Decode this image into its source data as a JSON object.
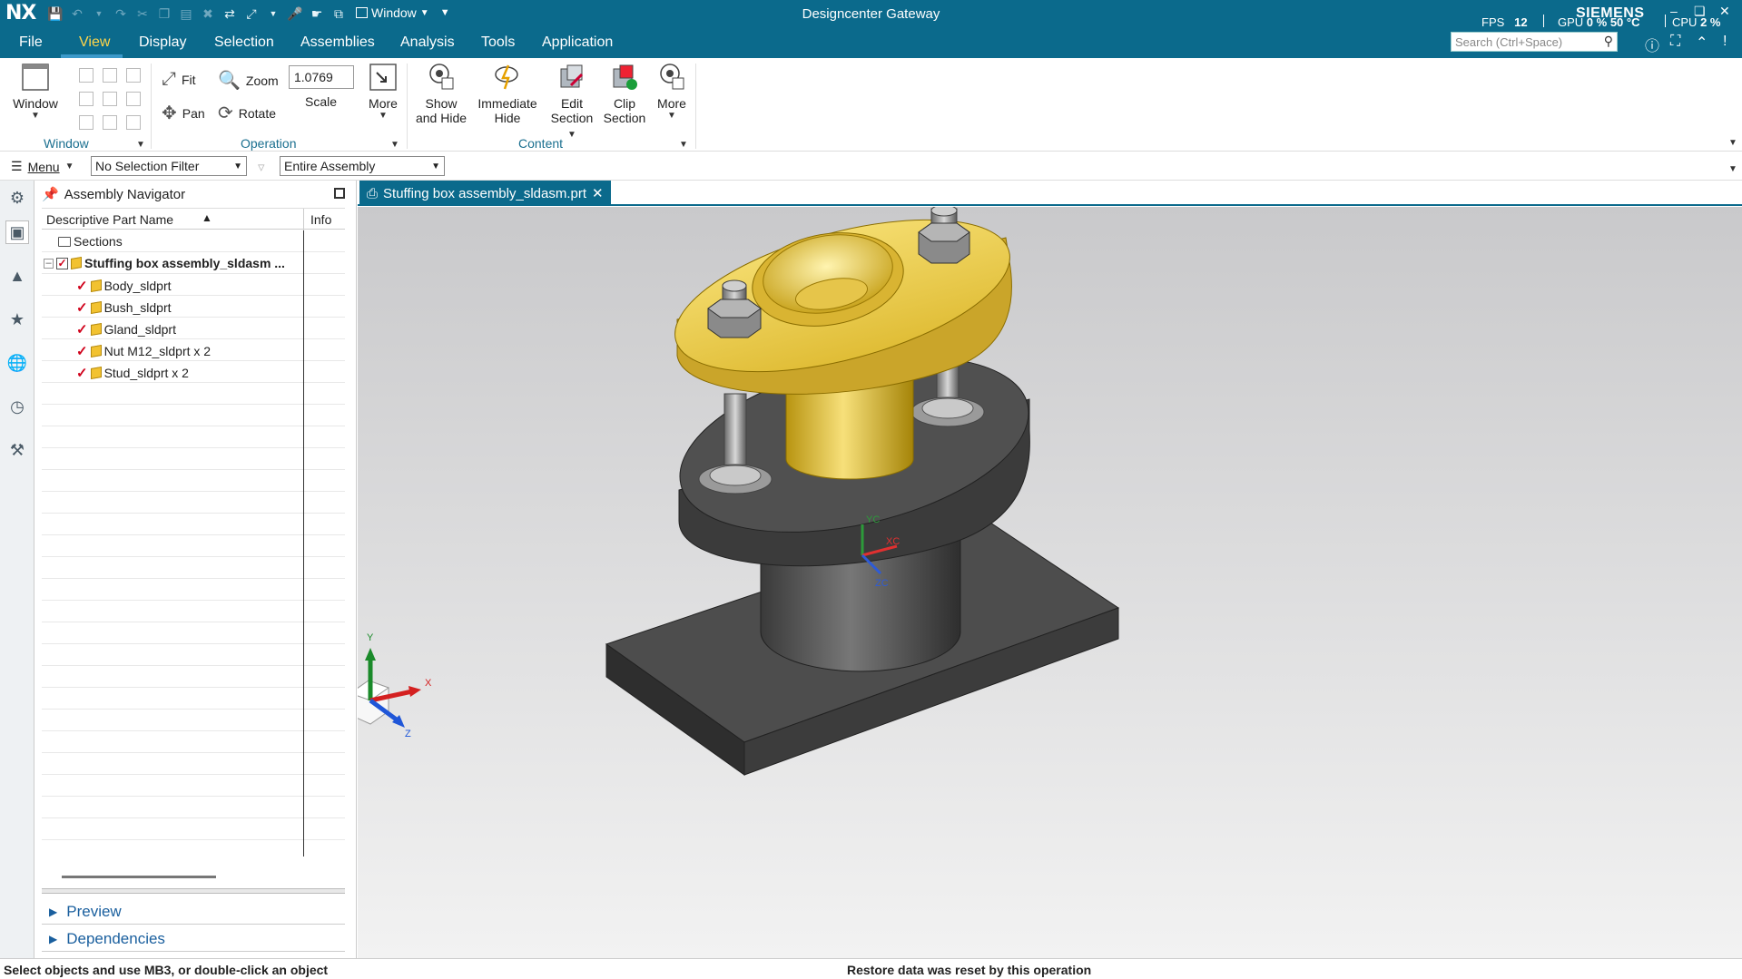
{
  "titlebar": {
    "logo": "NX",
    "window_menu": "Window",
    "app_title": "Designcenter Gateway",
    "brand": "SIEMENS",
    "fps_label": "FPS",
    "fps_value": "12",
    "gpu_label": "GPU",
    "gpu_value": "0 %",
    "gpu_temp": "50 °C",
    "cpu_label": "CPU",
    "cpu_value": "2 %"
  },
  "menubar": {
    "items": [
      "File",
      "View",
      "Display",
      "Selection",
      "Assemblies",
      "Analysis",
      "Tools",
      "Application"
    ],
    "active": "View",
    "search_placeholder": "Search (Ctrl+Space)"
  },
  "ribbon": {
    "window_btn": "Window",
    "group_window": "Window",
    "fit": "Fit",
    "zoom": "Zoom",
    "pan": "Pan",
    "rotate": "Rotate",
    "scale_value": "1.0769",
    "scale_label": "Scale",
    "more1": "More",
    "group_operation": "Operation",
    "show_hide_1": "Show",
    "show_hide_2": "and Hide",
    "immediate_hide_1": "Immediate",
    "immediate_hide_2": "Hide",
    "edit_section_1": "Edit",
    "edit_section_2": "Section",
    "clip_section_1": "Clip",
    "clip_section_2": "Section",
    "more2": "More",
    "group_content": "Content"
  },
  "selbar": {
    "menu": "Menu",
    "filter": "No Selection Filter",
    "scope": "Entire Assembly"
  },
  "navigator": {
    "title": "Assembly Navigator",
    "col_name": "Descriptive Part Name",
    "col_info": "Info",
    "rows": [
      {
        "label": "Sections"
      },
      {
        "label": "Stuffing box assembly_sldasm ..."
      },
      {
        "label": "Body_sldprt"
      },
      {
        "label": "Bush_sldprt"
      },
      {
        "label": "Gland_sldprt"
      },
      {
        "label": "Nut M12_sldprt x 2"
      },
      {
        "label": "Stud_sldprt x 2"
      }
    ],
    "preview": "Preview",
    "dependencies": "Dependencies"
  },
  "graphics": {
    "tab_label": "Stuffing box assembly_sldasm.prt",
    "wcs_labels": {
      "yc": "YC",
      "xc": "XC",
      "zc": "ZC"
    },
    "triad_labels": {
      "y": "Y",
      "x": "X",
      "z": "Z"
    }
  },
  "status": {
    "left": "Select objects and use MB3, or double-click an object",
    "center": "Restore data was reset by this operation"
  },
  "colors": {
    "brand_bar": "#0b6a8c",
    "active_menu": "#ffd54a",
    "gland": "#e3c23c",
    "body": "#555555"
  }
}
